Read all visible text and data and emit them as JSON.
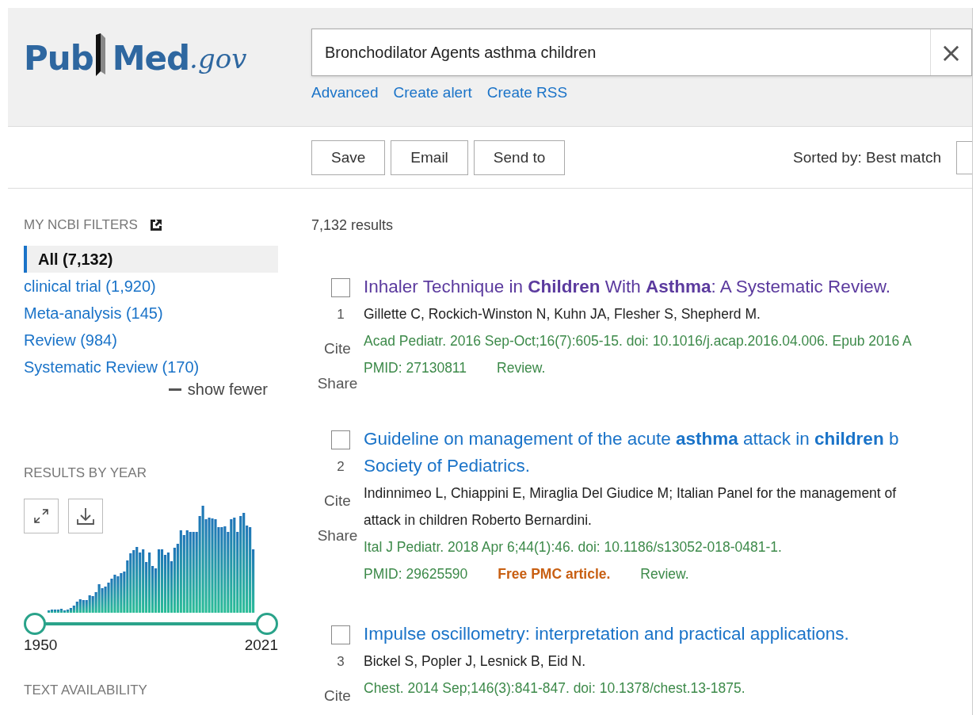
{
  "header": {
    "logo": {
      "pub": "Pub",
      "med": "Med",
      "domain": ".gov"
    },
    "search": {
      "value": "Bronchodilator Agents asthma children",
      "clear": "×"
    },
    "links": [
      "Advanced",
      "Create alert",
      "Create RSS"
    ]
  },
  "toolbar": {
    "buttons": [
      "Save",
      "Email",
      "Send to"
    ],
    "sort_label": "Sorted by: Best match"
  },
  "sidebar": {
    "filters_title": "MY NCBI FILTERS",
    "filters": [
      {
        "label": "All (7,132)",
        "selected": true
      },
      {
        "label": "clinical trial (1,920)",
        "selected": false
      },
      {
        "label": "Meta-analysis (145)",
        "selected": false
      },
      {
        "label": "Review (984)",
        "selected": false
      },
      {
        "label": "Systematic Review (170)",
        "selected": false
      }
    ],
    "show_fewer": "show fewer",
    "year_title": "RESULTS BY YEAR",
    "year_start": "1950",
    "year_end": "2021",
    "handles": [
      {
        "level": 0
      },
      {
        "level": 1
      }
    ],
    "availability_title": "TEXT AVAILABILITY"
  },
  "results_count": "7,132 results",
  "results": [
    {
      "number": "1",
      "checked": false,
      "visited": true,
      "title_lines": [
        "Inhaler Technique in **Children** With **Asthma**: A Systematic Review."
      ],
      "authors": [
        "Gillette C, Rockich-Winston N, Kuhn JA, Flesher S, Shepherd M."
      ],
      "citation": "Acad Pediatr. 2016 Sep-Oct;16(7):605-15. doi: 10.1016/j.acap.2016.04.006. Epub 2016 A",
      "pmid": "PMID: 27130811",
      "type": "Review.",
      "cite": "Cite",
      "share": "Share"
    },
    {
      "number": "2",
      "checked": false,
      "visited": false,
      "title_lines": [
        "Guideline on management of the acute **asthma** attack in **children** b",
        "Society of Pediatrics."
      ],
      "authors": [
        "Indinnimeo L, Chiappini E, Miraglia Del Giudice M; Italian Panel for the management of",
        "attack in children Roberto Bernardini."
      ],
      "citation": "Ital J Pediatr. 2018 Apr 6;44(1):46. doi: 10.1186/s13052-018-0481-1.",
      "pmid": "PMID: 29625590",
      "free": "Free PMC article.",
      "type": "Review.",
      "cite": "Cite",
      "share": "Share"
    },
    {
      "number": "3",
      "checked": false,
      "visited": false,
      "title_lines": [
        "Impulse oscillometry: interpretation and practical applications."
      ],
      "authors": [
        "Bickel S, Popler J, Lesnick B, Eid N."
      ],
      "citation": "Chest. 2014 Sep;146(3):841-847. doi: 10.1378/chest.13-1875.",
      "cite": "Cite"
    }
  ]
}
